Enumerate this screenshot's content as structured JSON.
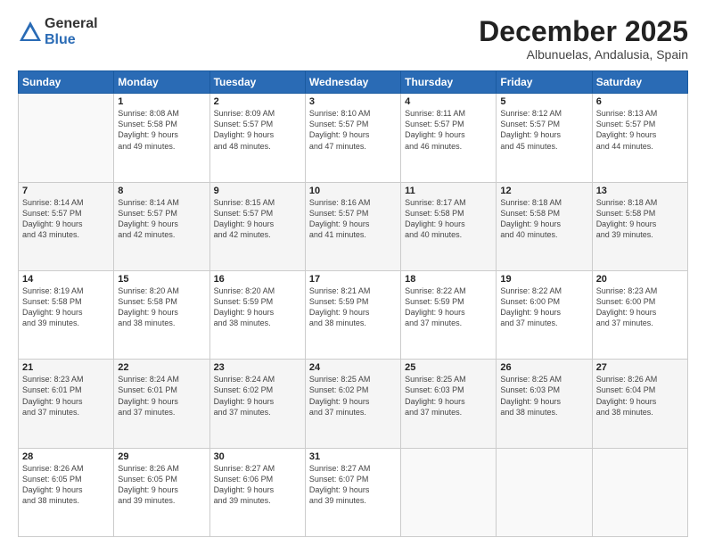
{
  "logo": {
    "general": "General",
    "blue": "Blue"
  },
  "header": {
    "title": "December 2025",
    "subtitle": "Albunuelas, Andalusia, Spain"
  },
  "weekdays": [
    "Sunday",
    "Monday",
    "Tuesday",
    "Wednesday",
    "Thursday",
    "Friday",
    "Saturday"
  ],
  "weeks": [
    [
      {
        "day": null,
        "info": null
      },
      {
        "day": "1",
        "info": "Sunrise: 8:08 AM\nSunset: 5:58 PM\nDaylight: 9 hours\nand 49 minutes."
      },
      {
        "day": "2",
        "info": "Sunrise: 8:09 AM\nSunset: 5:57 PM\nDaylight: 9 hours\nand 48 minutes."
      },
      {
        "day": "3",
        "info": "Sunrise: 8:10 AM\nSunset: 5:57 PM\nDaylight: 9 hours\nand 47 minutes."
      },
      {
        "day": "4",
        "info": "Sunrise: 8:11 AM\nSunset: 5:57 PM\nDaylight: 9 hours\nand 46 minutes."
      },
      {
        "day": "5",
        "info": "Sunrise: 8:12 AM\nSunset: 5:57 PM\nDaylight: 9 hours\nand 45 minutes."
      },
      {
        "day": "6",
        "info": "Sunrise: 8:13 AM\nSunset: 5:57 PM\nDaylight: 9 hours\nand 44 minutes."
      }
    ],
    [
      {
        "day": "7",
        "info": "Sunrise: 8:14 AM\nSunset: 5:57 PM\nDaylight: 9 hours\nand 43 minutes."
      },
      {
        "day": "8",
        "info": "Sunrise: 8:14 AM\nSunset: 5:57 PM\nDaylight: 9 hours\nand 42 minutes."
      },
      {
        "day": "9",
        "info": "Sunrise: 8:15 AM\nSunset: 5:57 PM\nDaylight: 9 hours\nand 42 minutes."
      },
      {
        "day": "10",
        "info": "Sunrise: 8:16 AM\nSunset: 5:57 PM\nDaylight: 9 hours\nand 41 minutes."
      },
      {
        "day": "11",
        "info": "Sunrise: 8:17 AM\nSunset: 5:58 PM\nDaylight: 9 hours\nand 40 minutes."
      },
      {
        "day": "12",
        "info": "Sunrise: 8:18 AM\nSunset: 5:58 PM\nDaylight: 9 hours\nand 40 minutes."
      },
      {
        "day": "13",
        "info": "Sunrise: 8:18 AM\nSunset: 5:58 PM\nDaylight: 9 hours\nand 39 minutes."
      }
    ],
    [
      {
        "day": "14",
        "info": "Sunrise: 8:19 AM\nSunset: 5:58 PM\nDaylight: 9 hours\nand 39 minutes."
      },
      {
        "day": "15",
        "info": "Sunrise: 8:20 AM\nSunset: 5:58 PM\nDaylight: 9 hours\nand 38 minutes."
      },
      {
        "day": "16",
        "info": "Sunrise: 8:20 AM\nSunset: 5:59 PM\nDaylight: 9 hours\nand 38 minutes."
      },
      {
        "day": "17",
        "info": "Sunrise: 8:21 AM\nSunset: 5:59 PM\nDaylight: 9 hours\nand 38 minutes."
      },
      {
        "day": "18",
        "info": "Sunrise: 8:22 AM\nSunset: 5:59 PM\nDaylight: 9 hours\nand 37 minutes."
      },
      {
        "day": "19",
        "info": "Sunrise: 8:22 AM\nSunset: 6:00 PM\nDaylight: 9 hours\nand 37 minutes."
      },
      {
        "day": "20",
        "info": "Sunrise: 8:23 AM\nSunset: 6:00 PM\nDaylight: 9 hours\nand 37 minutes."
      }
    ],
    [
      {
        "day": "21",
        "info": "Sunrise: 8:23 AM\nSunset: 6:01 PM\nDaylight: 9 hours\nand 37 minutes."
      },
      {
        "day": "22",
        "info": "Sunrise: 8:24 AM\nSunset: 6:01 PM\nDaylight: 9 hours\nand 37 minutes."
      },
      {
        "day": "23",
        "info": "Sunrise: 8:24 AM\nSunset: 6:02 PM\nDaylight: 9 hours\nand 37 minutes."
      },
      {
        "day": "24",
        "info": "Sunrise: 8:25 AM\nSunset: 6:02 PM\nDaylight: 9 hours\nand 37 minutes."
      },
      {
        "day": "25",
        "info": "Sunrise: 8:25 AM\nSunset: 6:03 PM\nDaylight: 9 hours\nand 37 minutes."
      },
      {
        "day": "26",
        "info": "Sunrise: 8:25 AM\nSunset: 6:03 PM\nDaylight: 9 hours\nand 38 minutes."
      },
      {
        "day": "27",
        "info": "Sunrise: 8:26 AM\nSunset: 6:04 PM\nDaylight: 9 hours\nand 38 minutes."
      }
    ],
    [
      {
        "day": "28",
        "info": "Sunrise: 8:26 AM\nSunset: 6:05 PM\nDaylight: 9 hours\nand 38 minutes."
      },
      {
        "day": "29",
        "info": "Sunrise: 8:26 AM\nSunset: 6:05 PM\nDaylight: 9 hours\nand 39 minutes."
      },
      {
        "day": "30",
        "info": "Sunrise: 8:27 AM\nSunset: 6:06 PM\nDaylight: 9 hours\nand 39 minutes."
      },
      {
        "day": "31",
        "info": "Sunrise: 8:27 AM\nSunset: 6:07 PM\nDaylight: 9 hours\nand 39 minutes."
      },
      {
        "day": null,
        "info": null
      },
      {
        "day": null,
        "info": null
      },
      {
        "day": null,
        "info": null
      }
    ]
  ]
}
